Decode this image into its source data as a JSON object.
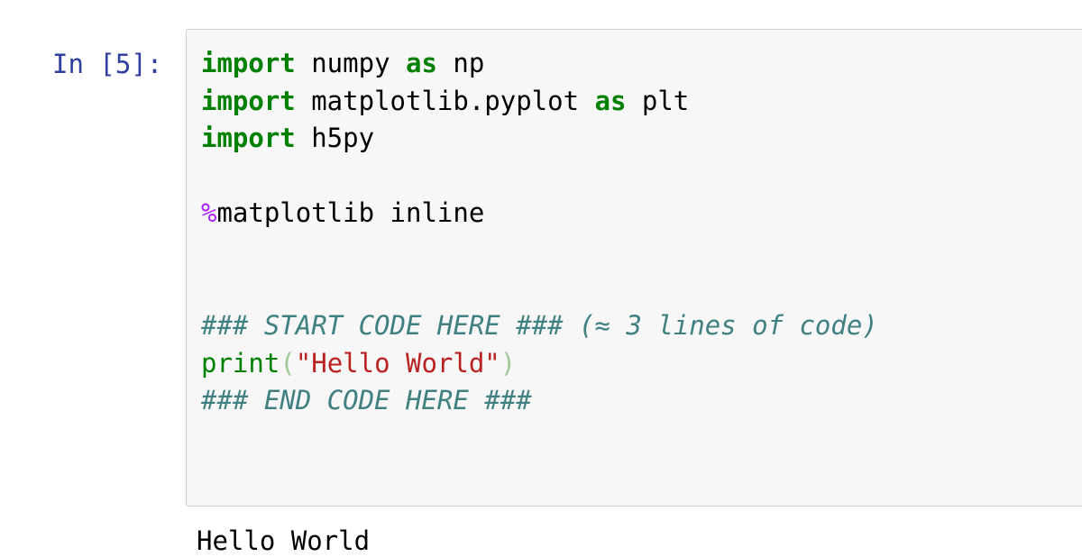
{
  "cell": {
    "prompt": "In [5]:",
    "lines": {
      "l1": {
        "kw1": "import",
        "rest1": " numpy ",
        "kw2": "as",
        "rest2": " np"
      },
      "l2": {
        "kw1": "import",
        "rest1": " matplotlib.pyplot ",
        "kw2": "as",
        "rest2": " plt"
      },
      "l3": {
        "kw1": "import",
        "rest1": " h5py"
      },
      "l5": {
        "magic": "%",
        "rest": "matplotlib inline"
      },
      "l8": {
        "comment": "### START CODE HERE ### (≈ 3 lines of code)"
      },
      "l9": {
        "fn": "print",
        "open": "(",
        "str": "\"Hello World\"",
        "close": ")"
      },
      "l10": {
        "comment": "### END CODE HERE ###"
      }
    },
    "output": "Hello World"
  },
  "colors": {
    "keyword": "#008000",
    "magic": "#aa22ff",
    "comment": "#408080",
    "string": "#ba2121",
    "prompt": "#303f9f",
    "cell_background": "#f7f7f7",
    "cell_border": "#cfcfcf"
  }
}
